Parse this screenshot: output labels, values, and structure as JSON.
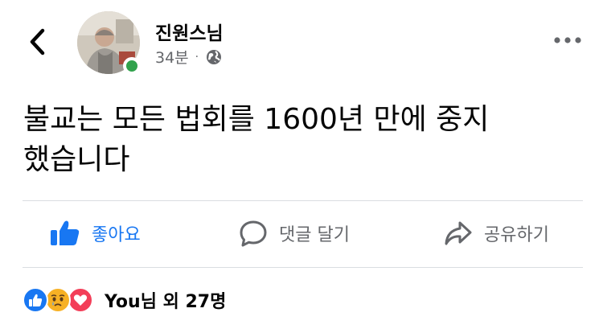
{
  "author": {
    "name": "진원스님",
    "time": "34분",
    "separator": "·",
    "audience_icon": "globe-icon",
    "online": true
  },
  "post": {
    "line1": "불교는 모든 법회를 1600년 만에 중지",
    "line2": "했습니다"
  },
  "actions": {
    "like": {
      "label": "좋아요",
      "icon": "thumbs-up-icon",
      "color": "#1877f2"
    },
    "comment": {
      "label": "댓글 달기",
      "icon": "comment-bubble-icon"
    },
    "share": {
      "label": "공유하기",
      "icon": "share-arrow-icon"
    }
  },
  "reactions": {
    "icons": [
      "like-reaction-icon",
      "sad-reaction-icon",
      "love-reaction-icon"
    ],
    "summary": "You님 외 27명"
  },
  "colors": {
    "brand_blue": "#1877f2",
    "secondary_text": "#65676b",
    "online_green": "#31a24c",
    "love_red": "#f33e58",
    "sad_yellow": "#f7b125"
  }
}
